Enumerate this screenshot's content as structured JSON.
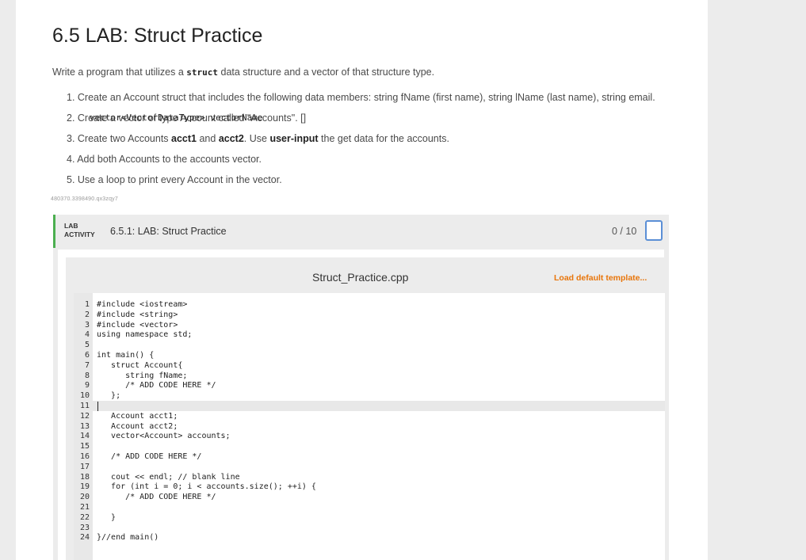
{
  "header": {
    "title": "6.5 LAB: Struct Practice"
  },
  "intro": {
    "before": "Write a program that utilizes a ",
    "code": "struct",
    "after": " data structure and a vector of that structure type."
  },
  "steps": {
    "s1": "1. Create an Account struct that includes the following data members: string fName (first name), string lName (last name), string email.",
    "s2_pre": "2. Create a vector of type Account called \"Accounts\". [",
    "s2_code": "vector<VectorDataType> vectorName",
    "s2_post": "]",
    "s3_a": "3. Create two Accounts ",
    "s3_b": "acct1",
    "s3_c": " and ",
    "s3_d": "acct2",
    "s3_e": ". Use ",
    "s3_f": "user-input",
    "s3_g": " the get data for the accounts.",
    "s4": "4. Add both Accounts to the accounts vector.",
    "s5": "5. Use a loop to print every Account in the vector."
  },
  "tag": "480370.3398490.qx3zqy7",
  "lab": {
    "label_top": "LAB",
    "label_bottom": "ACTIVITY",
    "title": "6.5.1: LAB: Struct Practice",
    "score": "0 / 10",
    "file_name": "Struct_Practice.cpp",
    "load_template": "Load default template..."
  },
  "code_lines": [
    {
      "n": "1",
      "t": "#include <iostream>"
    },
    {
      "n": "2",
      "t": "#include <string>"
    },
    {
      "n": "3",
      "t": "#include <vector>"
    },
    {
      "n": "4",
      "t": "using namespace std;"
    },
    {
      "n": "5",
      "t": ""
    },
    {
      "n": "6",
      "t": "int main() {"
    },
    {
      "n": "7",
      "t": "   struct Account{"
    },
    {
      "n": "8",
      "t": "      string fName;"
    },
    {
      "n": "9",
      "t": "      /* ADD CODE HERE */"
    },
    {
      "n": "10",
      "t": "   };"
    },
    {
      "n": "11",
      "t": ""
    },
    {
      "n": "12",
      "t": "   Account acct1;"
    },
    {
      "n": "13",
      "t": "   Account acct2;"
    },
    {
      "n": "14",
      "t": "   vector<Account> accounts;"
    },
    {
      "n": "15",
      "t": ""
    },
    {
      "n": "16",
      "t": "   /* ADD CODE HERE */"
    },
    {
      "n": "17",
      "t": ""
    },
    {
      "n": "18",
      "t": "   cout << endl; // blank line"
    },
    {
      "n": "19",
      "t": "   for (int i = 0; i < accounts.size(); ++i) {"
    },
    {
      "n": "20",
      "t": "      /* ADD CODE HERE */"
    },
    {
      "n": "21",
      "t": ""
    },
    {
      "n": "22",
      "t": "   }"
    },
    {
      "n": "23",
      "t": ""
    },
    {
      "n": "24",
      "t": "}//end main()"
    }
  ],
  "active_line": "11"
}
